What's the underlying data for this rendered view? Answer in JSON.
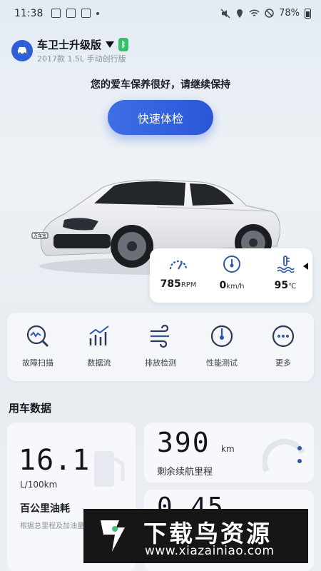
{
  "status_bar": {
    "time": "11:38",
    "battery": "78%"
  },
  "header": {
    "car_name": "车卫士升级版",
    "car_model": "2017款 1.5L 手动创行版",
    "health_message": "您的爱车保养很好，请继续保持",
    "quick_check_label": "快速体检"
  },
  "car_image": {
    "plate_text": "万车宝"
  },
  "gauges": [
    {
      "name": "rpm",
      "value": "785",
      "unit": "RPM"
    },
    {
      "name": "speed",
      "value": "0",
      "unit": "km/h"
    },
    {
      "name": "coolant",
      "value": "95",
      "unit": "℃"
    }
  ],
  "tools": [
    {
      "label": "故障扫描",
      "icon": "fault-scan-icon"
    },
    {
      "label": "数据流",
      "icon": "data-stream-icon"
    },
    {
      "label": "排放检测",
      "icon": "emission-icon"
    },
    {
      "label": "性能测试",
      "icon": "performance-icon"
    },
    {
      "label": "更多",
      "icon": "more-icon"
    }
  ],
  "usage": {
    "section_title": "用车数据",
    "fuel": {
      "value": "16.1",
      "unit": "L/100km",
      "title": "百公里油耗",
      "desc": "根据总里程及加油量"
    },
    "range": {
      "value": "390",
      "unit": "km",
      "title": "剩余续航里程"
    },
    "third": {
      "value": "0.45"
    }
  },
  "watermark": {
    "title": "下载鸟资源",
    "url": "www.xiazainiao.com"
  },
  "colors": {
    "accent": "#2f5fd6",
    "bluetooth": "#35c06a",
    "icon": "#2d5aa8"
  }
}
